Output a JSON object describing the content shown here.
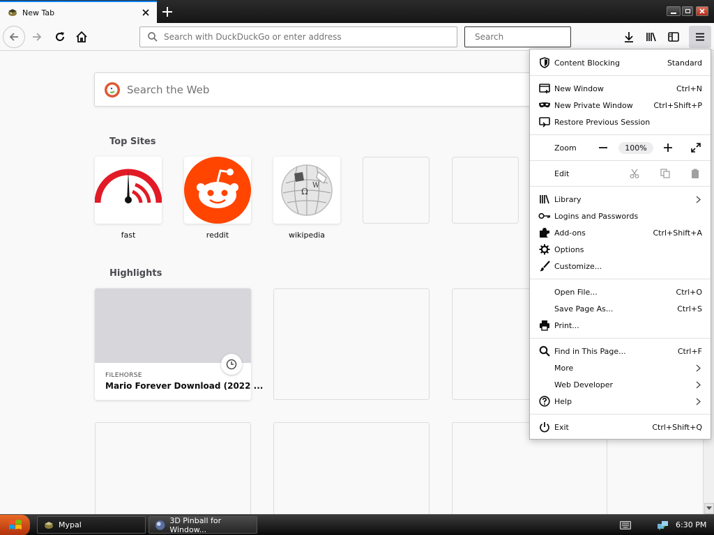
{
  "window": {
    "tab_title": "New Tab",
    "tab_favicon": "mypal-icon",
    "colors": {
      "tab_accent": "#0a84ff",
      "titlebar": "#1e1e1e",
      "menu_hover": "#d7d7db"
    }
  },
  "navbar": {
    "url_placeholder": "Search with DuckDuckGo or enter address",
    "search_placeholder": "Search",
    "icons": [
      "back-icon",
      "forward-icon",
      "reload-icon",
      "home-icon",
      "downloads-icon",
      "library-icon",
      "sidebar-icon",
      "hamburger-menu-icon"
    ]
  },
  "newtab": {
    "search_placeholder": "Search the Web",
    "top_sites_title": "Top Sites",
    "top_sites": [
      {
        "label": "fast",
        "icon": "fast-speedometer-icon"
      },
      {
        "label": "reddit",
        "icon": "reddit-icon"
      },
      {
        "label": "wikipedia",
        "icon": "wikipedia-globe-icon"
      },
      {
        "label": ""
      },
      {
        "label": ""
      }
    ],
    "highlights_title": "Highlights",
    "highlights": [
      {
        "source": "FILEHORSE",
        "title": "Mario Forever Download (2022 ..."
      }
    ]
  },
  "app_menu": {
    "content_blocking": {
      "label": "Content Blocking",
      "value": "Standard"
    },
    "new_window": {
      "label": "New Window",
      "shortcut": "Ctrl+N"
    },
    "new_private_window": {
      "label": "New Private Window",
      "shortcut": "Ctrl+Shift+P"
    },
    "restore_session": {
      "label": "Restore Previous Session"
    },
    "zoom": {
      "label": "Zoom",
      "value": "100%"
    },
    "edit": {
      "label": "Edit"
    },
    "library": {
      "label": "Library"
    },
    "logins": {
      "label": "Logins and Passwords"
    },
    "addons": {
      "label": "Add-ons",
      "shortcut": "Ctrl+Shift+A"
    },
    "options": {
      "label": "Options"
    },
    "customize": {
      "label": "Customize..."
    },
    "open_file": {
      "label": "Open File...",
      "shortcut": "Ctrl+O"
    },
    "save_page": {
      "label": "Save Page As...",
      "shortcut": "Ctrl+S"
    },
    "print": {
      "label": "Print..."
    },
    "find": {
      "label": "Find in This Page...",
      "shortcut": "Ctrl+F"
    },
    "more": {
      "label": "More"
    },
    "web_developer": {
      "label": "Web Developer"
    },
    "help": {
      "label": "Help"
    },
    "exit": {
      "label": "Exit",
      "shortcut": "Ctrl+Shift+Q"
    }
  },
  "taskbar": {
    "tasks": [
      {
        "label": "Mypal",
        "icon": "mypal-icon"
      },
      {
        "label": "3D Pinball for Window...",
        "icon": "pinball-icon"
      }
    ],
    "clock": "6:30 PM"
  }
}
